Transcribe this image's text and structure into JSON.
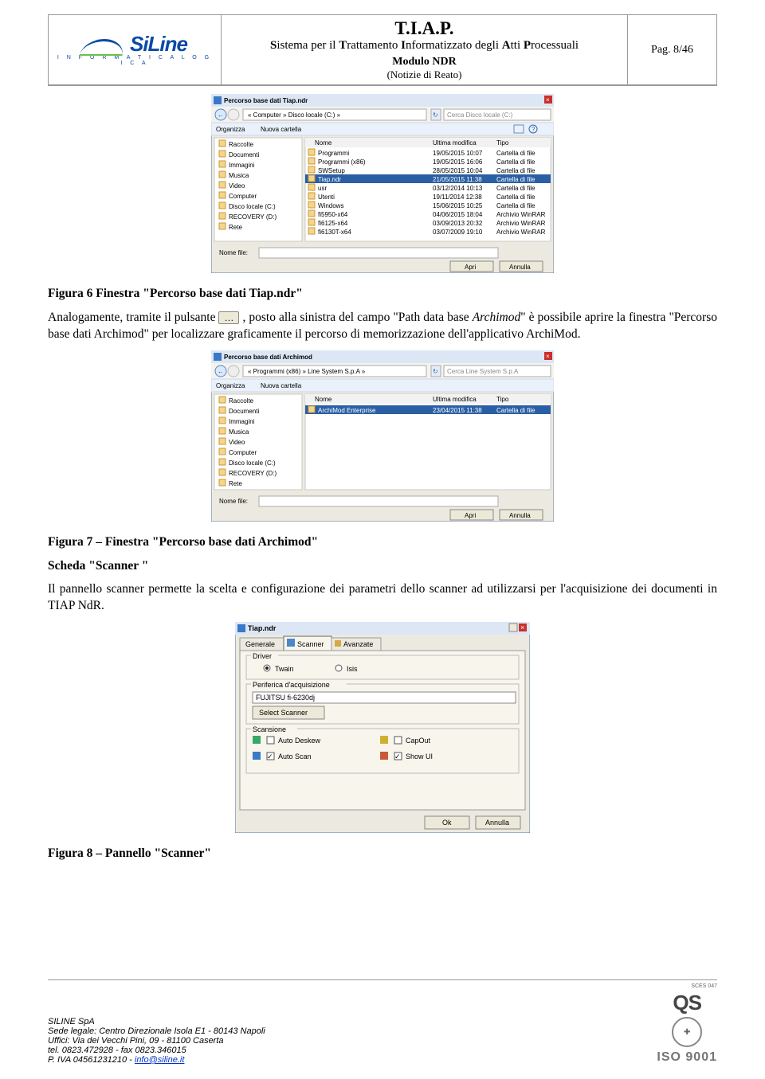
{
  "header": {
    "acronym": "T.I.A.P.",
    "subtitle_bold_1": "S",
    "subtitle_plain_1": "istema per il ",
    "subtitle_bold_2": "T",
    "subtitle_plain_2": "rattamento ",
    "subtitle_bold_3": "I",
    "subtitle_plain_3": "nformatizzato degli ",
    "subtitle_bold_4": "A",
    "subtitle_plain_4": "tti ",
    "subtitle_bold_5": "P",
    "subtitle_plain_5": "rocessuali",
    "module": "Modulo NDR",
    "module_sub": "(Notizie di Reato)",
    "page_label": "Pag. 8/46",
    "logo_main": "SiLine",
    "logo_sub": "I N F O R M A T I C A L O G I C A"
  },
  "screenshot1": {
    "title": "Percorso base dati Tiap.ndr",
    "breadcrumb": "« Computer » Disco locale (C:) »",
    "search_placeholder": "Cerca Disco locale (C:)",
    "organize": "Organizza",
    "newfolder": "Nuova cartella",
    "cols": {
      "name": "Nome",
      "date": "Ultima modifica",
      "type": "Tipo"
    },
    "tree": [
      "Raccolte",
      "Documenti",
      "Immagini",
      "Musica",
      "Video",
      "Computer",
      "Disco locale (C:)",
      "RECOVERY (D:)",
      "Rete"
    ],
    "rows": [
      {
        "n": "Programmi",
        "d": "19/05/2015 10:07",
        "t": "Cartella di file"
      },
      {
        "n": "Programmi (x86)",
        "d": "19/05/2015 16:06",
        "t": "Cartella di file"
      },
      {
        "n": "SWSetup",
        "d": "28/05/2015 10:04",
        "t": "Cartella di file"
      },
      {
        "n": "Tiap.ndr",
        "d": "21/05/2015 11:38",
        "t": "Cartella di file",
        "sel": true
      },
      {
        "n": "usr",
        "d": "03/12/2014 10:13",
        "t": "Cartella di file"
      },
      {
        "n": "Utenti",
        "d": "19/11/2014 12:38",
        "t": "Cartella di file"
      },
      {
        "n": "Windows",
        "d": "15/06/2015 10:25",
        "t": "Cartella di file"
      },
      {
        "n": "fi5950-x64",
        "d": "04/06/2015 18:04",
        "t": "Archivio WinRAR"
      },
      {
        "n": "fi6125-x64",
        "d": "03/09/2013 20:32",
        "t": "Archivio WinRAR"
      },
      {
        "n": "fi6130T-x64",
        "d": "03/07/2009 19:10",
        "t": "Archivio WinRAR"
      }
    ],
    "filename_label": "Nome file:",
    "btn_open": "Apri",
    "btn_cancel": "Annulla"
  },
  "caption6": "Figura 6 Finestra \"Percorso base dati Tiap.ndr\"",
  "para1_a": "Analogamente, tramite il pulsante ",
  "para1_b": ", posto alla sinistra del campo \"Path data base ",
  "para1_c": "Archimod",
  "para1_d": "\" è possibile aprire la finestra \"Percorso base dati Archimod\" per localizzare graficamente il percorso di memorizzazione dell'applicativo ArchiMod.",
  "screenshot2": {
    "title": "Percorso base dati Archimod",
    "breadcrumb": "« Programmi (x86) » Line System S.p.A »",
    "search_placeholder": "Cerca Line System S.p.A",
    "organize": "Organizza",
    "newfolder": "Nuova cartella",
    "cols": {
      "name": "Nome",
      "date": "Ultima modifica",
      "type": "Tipo"
    },
    "tree": [
      "Raccolte",
      "Documenti",
      "Immagini",
      "Musica",
      "Video",
      "Computer",
      "Disco locale (C:)",
      "RECOVERY (D:)",
      "Rete"
    ],
    "rows": [
      {
        "n": "ArchiMod Enterprise",
        "d": "23/04/2015 11:38",
        "t": "Cartella di file",
        "sel": true
      }
    ],
    "filename_label": "Nome file:",
    "btn_open": "Apri",
    "btn_cancel": "Annulla"
  },
  "caption7": "Figura 7 – Finestra \"Percorso base dati Archimod\"",
  "section_scanner_head": "Scheda \"Scanner \"",
  "para_scanner": "Il pannello scanner permette la scelta e configurazione dei parametri dello scanner ad utilizzarsi per l'acquisizione dei documenti in TIAP NdR.",
  "screenshot3": {
    "title": "Tiap.ndr",
    "tabs": [
      "Generale",
      "Scanner",
      "Avanzate"
    ],
    "group_driver": "Driver",
    "driver_opts": [
      "Twain",
      "Isis"
    ],
    "group_periferica": "Periferica d'acquisizione",
    "device": "FUJITSU fi-6230dj",
    "btn_select": "Select Scanner",
    "group_scansione": "Scansione",
    "chk": [
      {
        "label": "Auto Deskew",
        "checked": false
      },
      {
        "label": "Auto Scan",
        "checked": true
      },
      {
        "label": "CapOut",
        "checked": false
      },
      {
        "label": "Show UI",
        "checked": true
      }
    ],
    "btn_ok": "Ok",
    "btn_cancel": "Annulla"
  },
  "caption8": "Figura 8 – Pannello \"Scanner\"",
  "footer": {
    "company": "SILINE SpA",
    "addr1": "Sede legale: Centro Direzionale Isola E1 - 80143 Napoli",
    "addr2": "Uffici: Via dei Vecchi Pini, 09 - 81100 Caserta",
    "tel": "tel. 0823.472928 - fax 0823.346015",
    "piva_pre": "P. IVA 04561231210 - ",
    "email": "info@siline.it",
    "sces": "SCES 047",
    "iso": "ISO 9001"
  }
}
